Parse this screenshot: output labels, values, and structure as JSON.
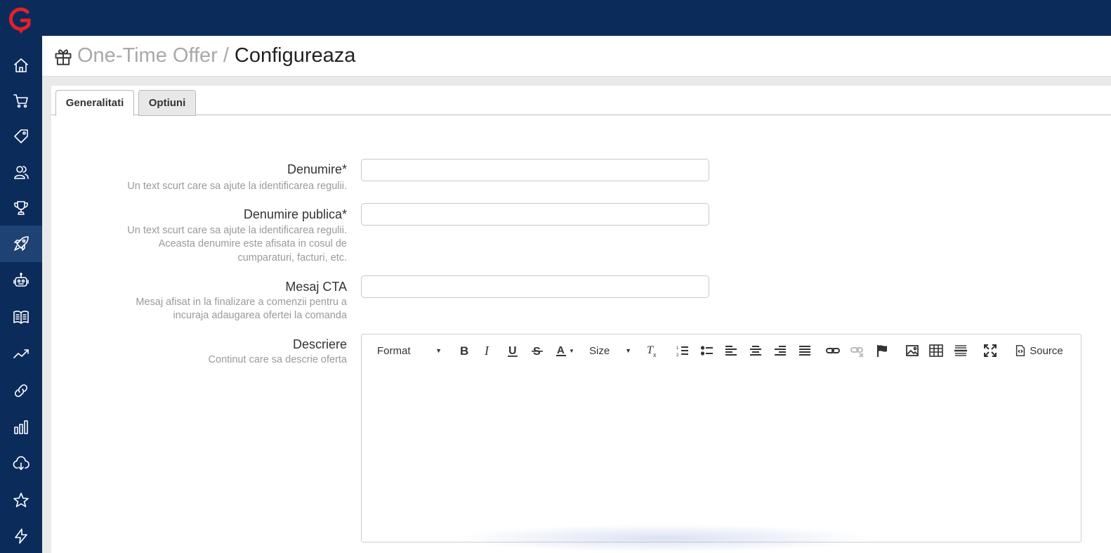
{
  "breadcrumb": {
    "parent": "One-Time Offer",
    "separator": "/",
    "current": "Configureaza"
  },
  "tabs": [
    {
      "label": "Generalitati",
      "active": true
    },
    {
      "label": "Optiuni",
      "active": false
    }
  ],
  "form": {
    "name": {
      "label": "Denumire*",
      "help": "Un text scurt care sa ajute la identificarea regulii.",
      "value": ""
    },
    "public_name": {
      "label": "Denumire publica*",
      "help_lines": [
        "Un text scurt care sa ajute la identificarea regulii.",
        "Aceasta denumire este afisata in cosul de",
        "cumparaturi, facturi, etc."
      ],
      "value": ""
    },
    "cta": {
      "label": "Mesaj CTA",
      "help_lines": [
        "Mesaj afisat in la finalizare a comenzii pentru a",
        "incuraja adaugarea ofertei la comanda"
      ],
      "value": ""
    },
    "description": {
      "label": "Descriere",
      "help": "Continut care sa descrie oferta"
    }
  },
  "editor": {
    "format_label": "Format",
    "size_label": "Size",
    "source_label": "Source"
  },
  "sidebar": {
    "icons": [
      "home-icon",
      "cart-icon",
      "tag-icon",
      "users-icon",
      "trophy-icon",
      "rocket-icon",
      "robot-icon",
      "book-icon",
      "trend-icon",
      "link-icon",
      "chart-icon",
      "cloud-download-icon",
      "star-icon",
      "bolt-icon"
    ],
    "active_index": 5
  },
  "colors": {
    "navy": "#0b2b5b",
    "active_item": "#1e4273",
    "logo_red": "#e32128"
  }
}
